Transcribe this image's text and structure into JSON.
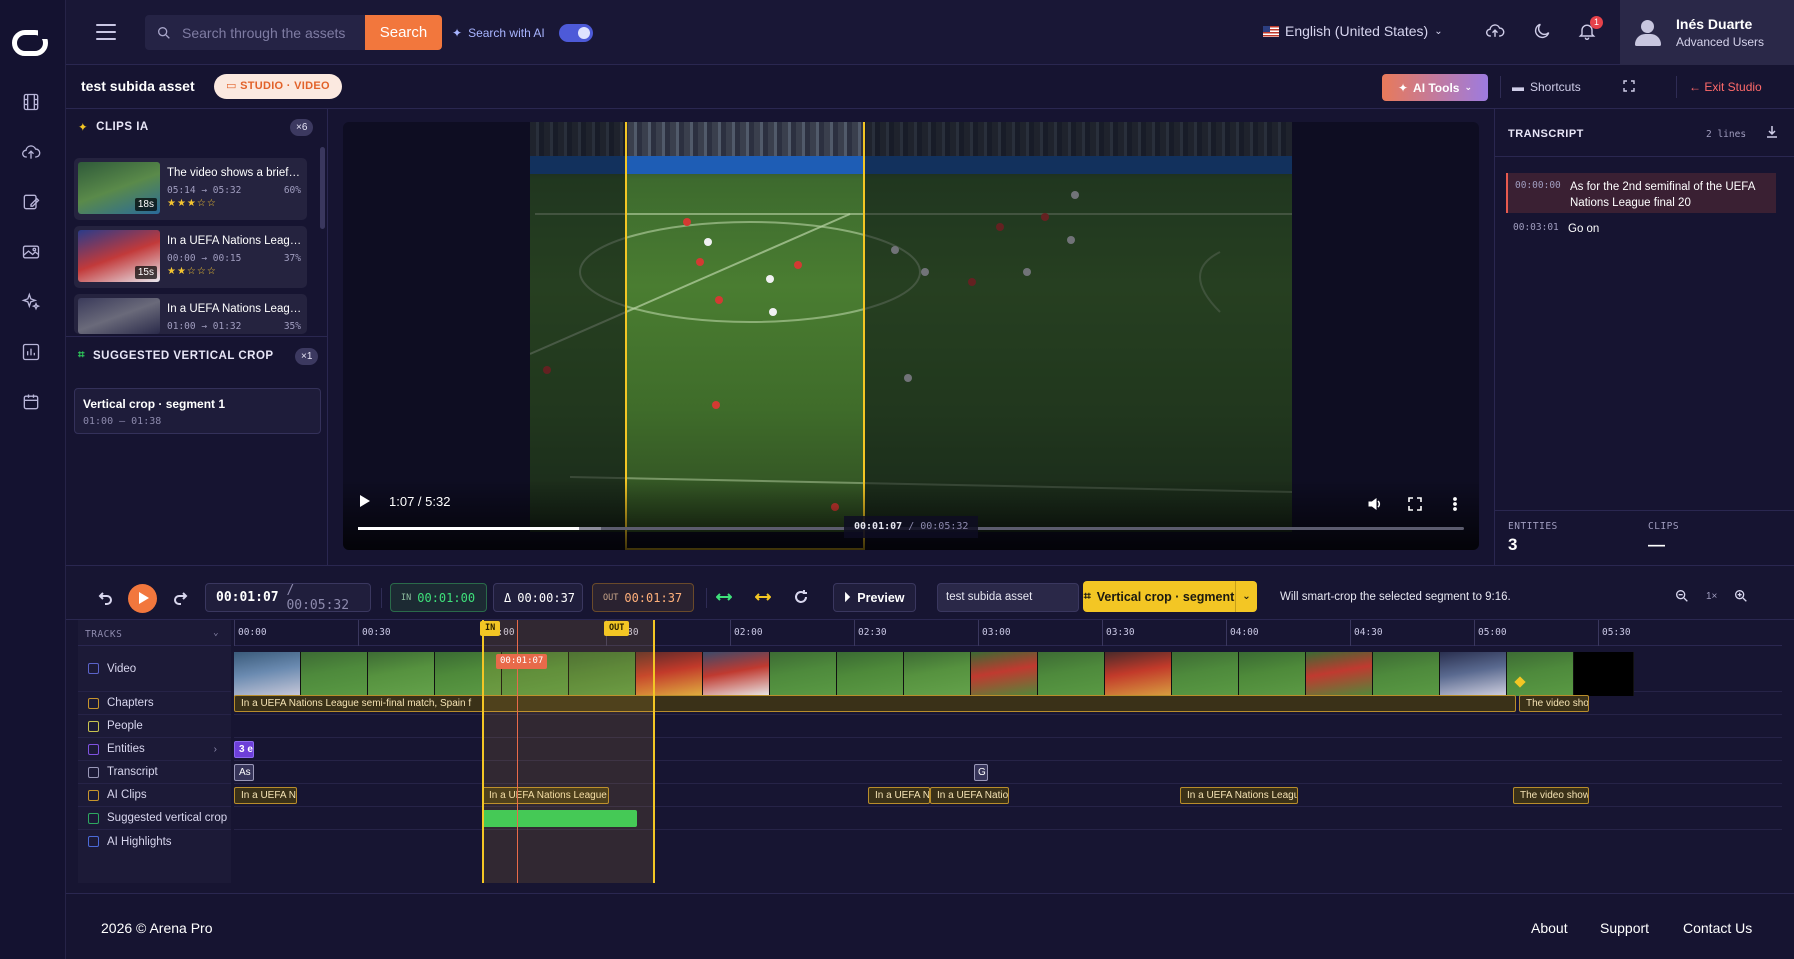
{
  "colors": {
    "accent_orange": "#f2773d",
    "accent_yellow": "#f3c624",
    "bg": "#161431",
    "green": "#2ecc5a",
    "purple": "#6d3fd8"
  },
  "rail": {
    "icons": [
      "logo-icon",
      "film-icon",
      "upload-icon",
      "edit-icon",
      "gallery-icon",
      "sparkles-icon",
      "chart-icon",
      "calendar-icon"
    ]
  },
  "header": {
    "search_placeholder": "Search through the assets",
    "search_button": "Search",
    "ai_search_label": "Search with AI",
    "language": "English (United States)",
    "notification_count": "1",
    "user_name": "Inés Duarte",
    "user_role": "Advanced Users"
  },
  "subheader": {
    "asset_title": "test subida asset",
    "badge": "STUDIO · VIDEO",
    "ai_tools": "AI Tools",
    "shortcuts": "Shortcuts",
    "exit": "Exit Studio"
  },
  "left": {
    "clips_title": "CLIPS IA",
    "clips_count": "×6",
    "clips": [
      {
        "title": "The video shows a brief o...",
        "time": "05:14 → 05:32",
        "pct": "60%",
        "stars": "★★★☆☆",
        "duration": "18s"
      },
      {
        "title": "In a UEFA Nations League...",
        "time": "00:00 → 00:15",
        "pct": "37%",
        "stars": "★★☆☆☆",
        "duration": "15s"
      },
      {
        "title": "In a UEFA Nations League...",
        "time": "01:00 → 01:32",
        "pct": "35%",
        "stars": "",
        "duration": ""
      }
    ],
    "crop_title": "SUGGESTED VERTICAL CROP",
    "crop_count": "×1",
    "crop_item_title": "Vertical crop · segment 1",
    "crop_item_time": "01:00 – 01:38"
  },
  "player": {
    "time": "1:07 / 5:32",
    "readout_current": "00:01:07",
    "readout_total": "/ 00:05:32",
    "progress": 0.2,
    "buffered": 0.22
  },
  "transcript": {
    "title": "TRANSCRIPT",
    "lines_count": "2 lines",
    "rows": [
      {
        "ts": "00:00:00",
        "text": "As for the 2nd semifinal of the UEFA Nations League final 20"
      },
      {
        "ts": "00:03:01",
        "text": "Go on"
      }
    ],
    "entities_label": "ENTITIES",
    "entities_value": "3",
    "clips_label": "CLIPS",
    "clips_value": "—"
  },
  "timeline": {
    "current": "00:01:07",
    "total": "/ 00:05:32",
    "in_label": "IN",
    "in_time": "00:01:00",
    "delta_label": "Δ",
    "delta_time": "00:00:37",
    "out_label": "OUT",
    "out_time": "00:01:37",
    "preview": "Preview",
    "clip_name": "test subida asset",
    "vc_button": "Vertical crop · segment",
    "vc_hint": "Will smart-crop the selected segment to 9:16.",
    "zoom": "1×",
    "tracks_header": "TRACKS",
    "ticks": [
      "00:00",
      "00:30",
      "01:00",
      "01:30",
      "02:00",
      "02:30",
      "03:00",
      "03:30",
      "04:00",
      "04:30",
      "05:00",
      "05:30"
    ],
    "playhead_label": "00:01:07",
    "tracks": [
      {
        "name": "Video",
        "color": "#5b63c9"
      },
      {
        "name": "Chapters",
        "color": "#c7952c"
      },
      {
        "name": "People",
        "color": "#c7c24f"
      },
      {
        "name": "Entities",
        "color": "#7f52e0"
      },
      {
        "name": "Transcript",
        "color": "#9a98b8"
      },
      {
        "name": "AI Clips",
        "color": "#c7952c"
      },
      {
        "name": "Suggested vertical crop",
        "color": "#2ea860"
      },
      {
        "name": "AI Highlights",
        "color": "#4b6ad8"
      }
    ],
    "chapters": [
      {
        "text": "In a UEFA Nations League semi-final match, Spain f"
      },
      {
        "text": "The video shows a"
      }
    ],
    "entities_seg": "3 e",
    "transcript_segs": [
      "As",
      "G"
    ],
    "ai_clips": [
      "In a UEFA Nati",
      "In a UEFA Nations League sem",
      "In a UEFA Nat",
      "In a UEFA Nations",
      "In a UEFA Nations League s",
      "The video shows"
    ]
  },
  "footer": {
    "copyright": "2026 © Arena Pro",
    "links": [
      "About",
      "Support",
      "Contact Us"
    ]
  }
}
